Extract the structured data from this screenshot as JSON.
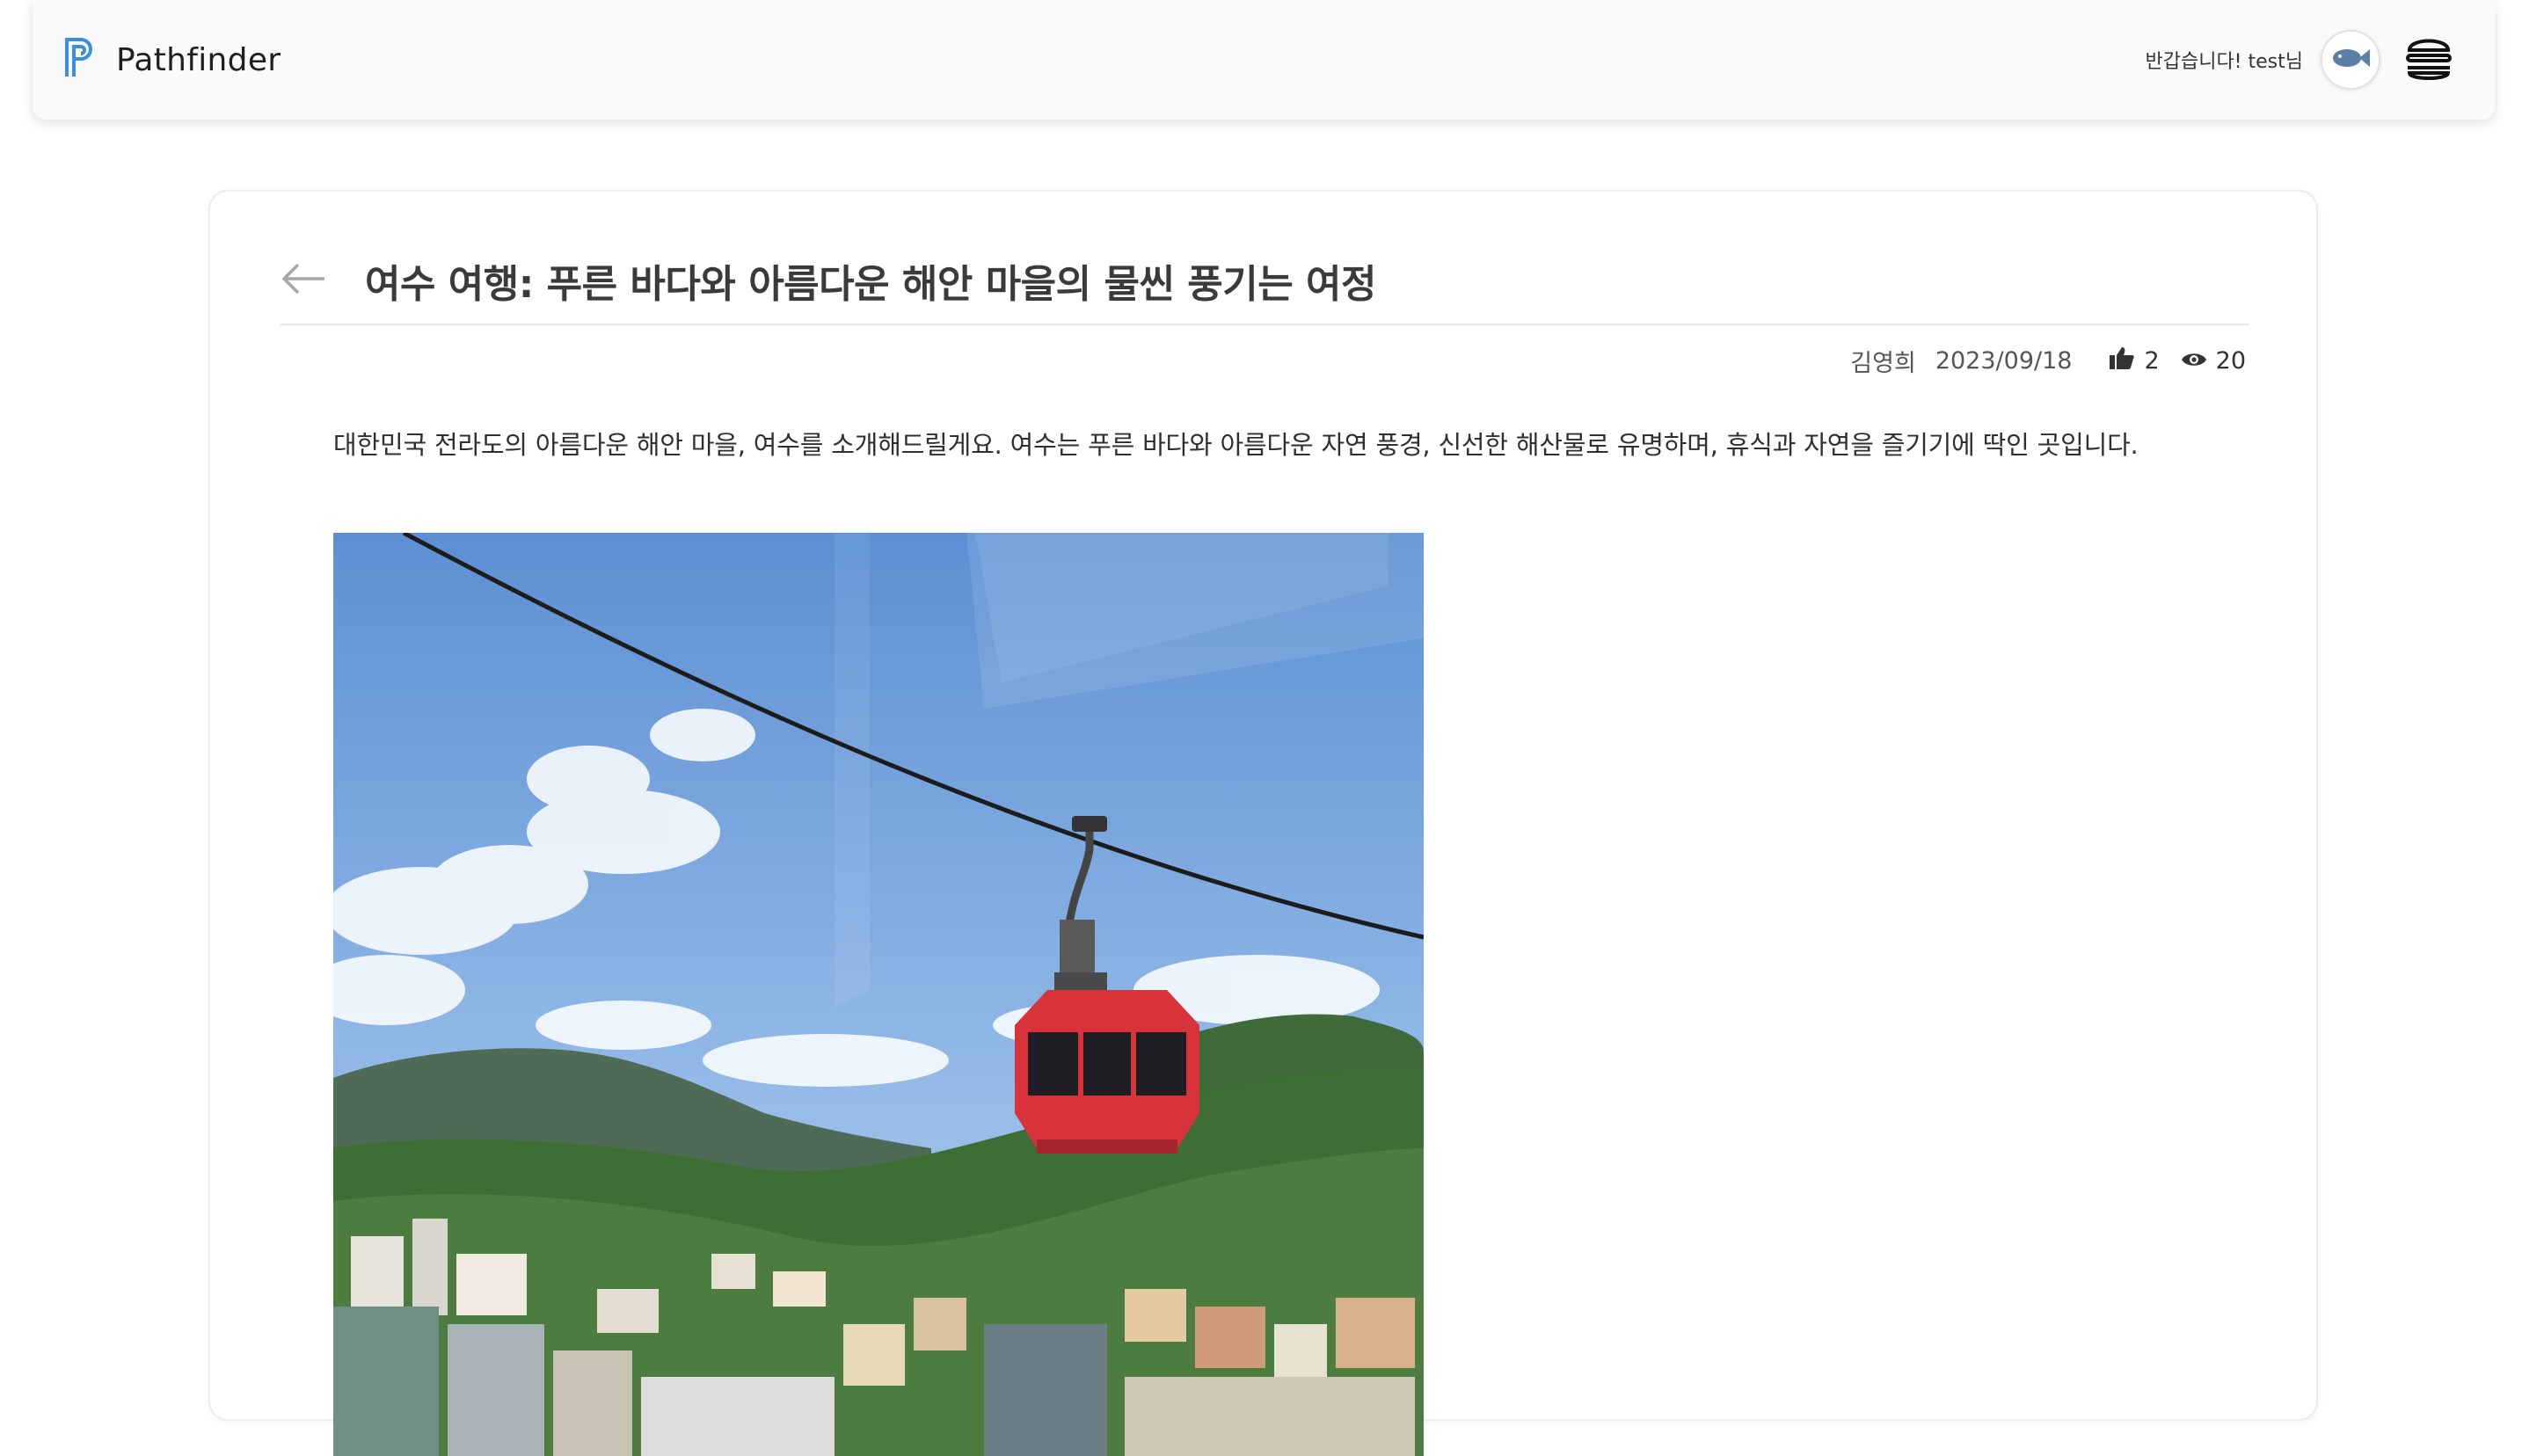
{
  "header": {
    "brand_name": "Pathfinder",
    "greeting": "반갑습니다! test님"
  },
  "post": {
    "title": "여수 여행: 푸른 바다와 아름다운 해안 마을의 물씬 풍기는 여정",
    "author": "김영희",
    "date": "2023/09/18",
    "likes": "2",
    "views": "20",
    "body": "대한민국 전라도의 아름다운 해안 마을, 여수를 소개해드릴게요. 여수는 푸른 바다와 아름다운 자연 풍경, 신선한 해산물로 유명하며, 휴식과 자연을 즐기기에 딱인 곳입니다."
  },
  "icons": {
    "logo": "pathfinder-logo-icon",
    "avatar": "fish-icon",
    "menu": "hamburger-menu-icon",
    "back": "arrow-left-icon",
    "like": "thumbs-up-icon",
    "view": "eye-icon"
  },
  "colors": {
    "brand": "#3b8fd9",
    "gondola": "#d8323a",
    "sky": "#6f9fd8"
  }
}
